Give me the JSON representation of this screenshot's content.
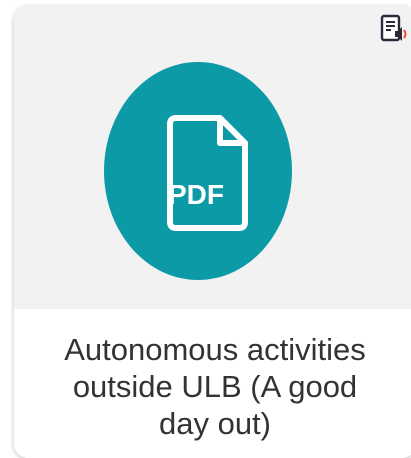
{
  "card": {
    "title": "Autonomous activities outside ULB (A good day out)",
    "file_type_label": "PDF",
    "icons": {
      "main": "pdf-document-icon",
      "audio": "read-aloud-speaker-icon"
    },
    "colors": {
      "accent": "#0c9aa7",
      "card_background": "#f2f2f2",
      "caption_background": "#ffffff",
      "text": "#333333",
      "speaker_accent": "#e8532f"
    }
  }
}
